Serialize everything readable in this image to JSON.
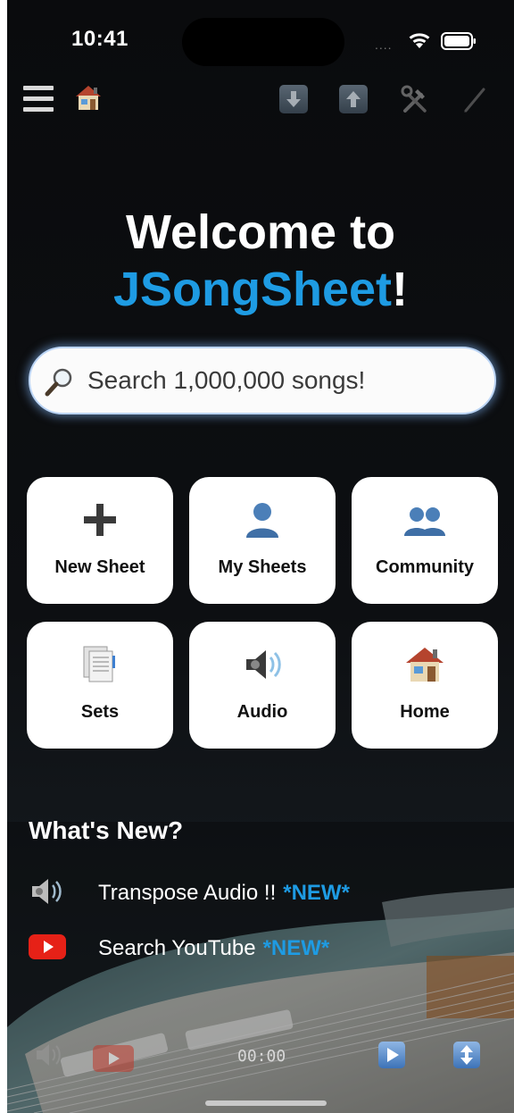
{
  "status_bar": {
    "time": "10:41",
    "signal": "....",
    "icons": [
      "wifi-icon",
      "battery-icon"
    ]
  },
  "toolbar": {
    "icons": [
      "menu-icon",
      "home-icon",
      "download-icon",
      "upload-icon",
      "tools-icon",
      "pen-icon"
    ]
  },
  "welcome": {
    "line1": "Welcome to",
    "brand": "JSongSheet",
    "suffix": "!",
    "brand_color": "#1e9be3"
  },
  "search": {
    "placeholder": "Search 1,000,000 songs!",
    "value": ""
  },
  "tiles": [
    {
      "label": "New Sheet",
      "icon": "plus-icon"
    },
    {
      "label": "My Sheets",
      "icon": "person-icon"
    },
    {
      "label": "Community",
      "icon": "people-icon"
    },
    {
      "label": "Sets",
      "icon": "documents-icon"
    },
    {
      "label": "Audio",
      "icon": "speaker-icon"
    },
    {
      "label": "Home",
      "icon": "house-icon"
    }
  ],
  "whats_new": {
    "title": "What's New?",
    "items": [
      {
        "text": "Transpose Audio !!",
        "tag": "*NEW*",
        "icon": "speaker-icon"
      },
      {
        "text": "Search YouTube",
        "tag": "*NEW*",
        "icon": "youtube-icon"
      }
    ],
    "tag_color": "#1e9be3"
  },
  "player": {
    "time": "00:00",
    "icons": [
      "speaker-icon",
      "youtube-icon",
      "play-icon",
      "scroll-icon"
    ]
  }
}
